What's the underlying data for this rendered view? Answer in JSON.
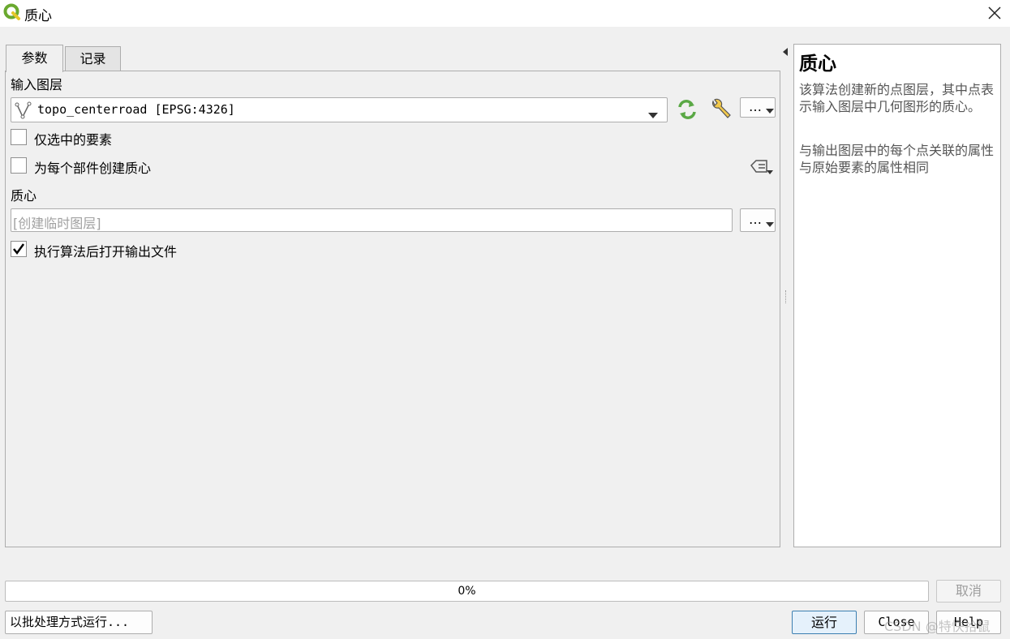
{
  "window": {
    "title": "质心",
    "icon": "qgis-icon",
    "close_icon": "close-icon"
  },
  "tabs": [
    {
      "label": "参数"
    },
    {
      "label": "记录"
    }
  ],
  "params": {
    "input_layer_label": "输入图层",
    "input_layer_value": "topo_centerroad [EPSG:4326]",
    "selected_only_label": "仅选中的要素",
    "selected_only_checked": false,
    "per_part_label": "为每个部件创建质心",
    "per_part_checked": false,
    "output_label": "质心",
    "output_placeholder": "[创建临时图层]",
    "open_after_label": "执行算法后打开输出文件",
    "open_after_checked": true,
    "more_button": "…"
  },
  "help": {
    "title": "质心",
    "para1": "该算法创建新的点图层，其中点表示输入图层中几何图形的质心。",
    "para2": "与输出图层中的每个点关联的属性与原始要素的属性相同"
  },
  "progress": {
    "text": "0%",
    "value_percent": 0
  },
  "buttons": {
    "cancel": "取消",
    "batch": "以批处理方式运行...",
    "run": "运行",
    "close": "Close",
    "help": "Help"
  },
  "watermark": "CSDN @特快拾鼠"
}
